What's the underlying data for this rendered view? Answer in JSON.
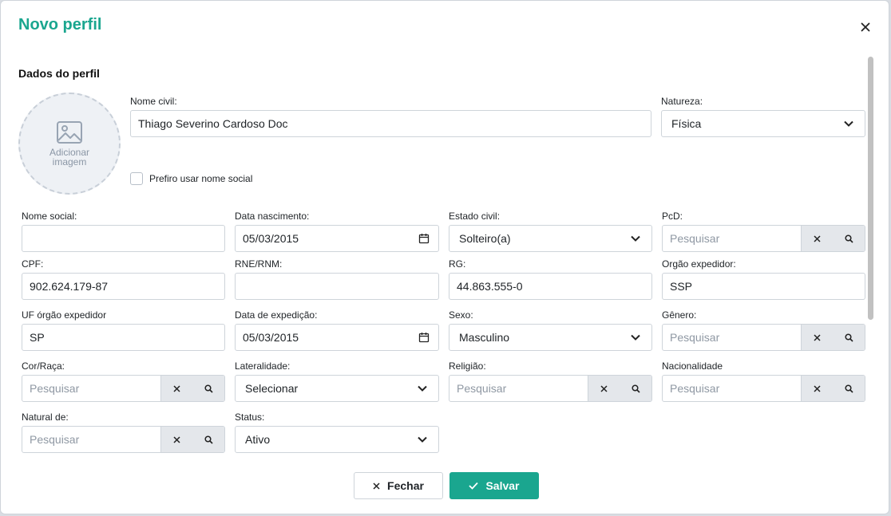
{
  "modal": {
    "title": "Novo perfil"
  },
  "section": {
    "title": "Dados do perfil"
  },
  "avatar": {
    "label_line1": "Adicionar",
    "label_line2": "imagem"
  },
  "nome_civil": {
    "label": "Nome civil:",
    "value": "Thiago Severino Cardoso Doc"
  },
  "natureza": {
    "label": "Natureza:",
    "value": "Física"
  },
  "nome_social_check": {
    "label": "Prefiro usar nome social",
    "checked": false
  },
  "nome_social": {
    "label": "Nome social:",
    "value": ""
  },
  "data_nascimento": {
    "label": "Data nascimento:",
    "value": "05/03/2015"
  },
  "estado_civil": {
    "label": "Estado civil:",
    "value": "Solteiro(a)"
  },
  "pcd": {
    "label": "PcD:",
    "placeholder": "Pesquisar"
  },
  "cpf": {
    "label": "CPF:",
    "value": "902.624.179-87"
  },
  "rne": {
    "label": "RNE/RNM:",
    "value": ""
  },
  "rg": {
    "label": "RG:",
    "value": "44.863.555-0"
  },
  "orgao_expedidor": {
    "label": "Orgão expedidor:",
    "value": "SSP"
  },
  "uf_orgao": {
    "label": "UF órgão expedidor",
    "value": "SP"
  },
  "data_expedicao": {
    "label": "Data de expedição:",
    "value": "05/03/2015"
  },
  "sexo": {
    "label": "Sexo:",
    "value": "Masculino"
  },
  "genero": {
    "label": "Gênero:",
    "placeholder": "Pesquisar"
  },
  "cor_raca": {
    "label": "Cor/Raça:",
    "placeholder": "Pesquisar"
  },
  "lateralidade": {
    "label": "Lateralidade:",
    "value": "Selecionar"
  },
  "religiao": {
    "label": "Religião:",
    "placeholder": "Pesquisar"
  },
  "nacionalidade": {
    "label": "Nacionalidade",
    "placeholder": "Pesquisar"
  },
  "natural_de": {
    "label": "Natural de:",
    "placeholder": "Pesquisar"
  },
  "status": {
    "label": "Status:",
    "value": "Ativo"
  },
  "footer": {
    "close_label": "Fechar",
    "save_label": "Salvar"
  },
  "colors": {
    "accent": "#1aa68f",
    "input_border": "#ced4da",
    "button_bg": "#e4e7eb"
  }
}
